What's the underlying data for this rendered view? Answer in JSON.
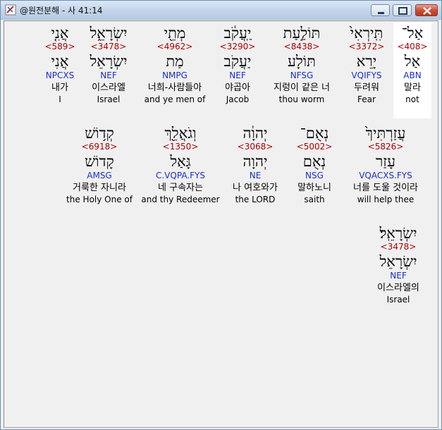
{
  "window": {
    "title": "@원전분해 - 사 41:14"
  },
  "words": [
    {
      "hebrew": "אַל־",
      "strong": "<408>",
      "lemma": "אַל",
      "morph": "ABN",
      "korean": "말라",
      "english": "not"
    },
    {
      "hebrew": "תִּֽירְאִי֙",
      "strong": "<3372>",
      "lemma": "יָרֵא",
      "morph": "VQIFYS",
      "korean": "두려워",
      "english": "Fear"
    },
    {
      "hebrew": "תּוֹלַ֣עַת",
      "strong": "<8438>",
      "lemma": "תּוֹלָע",
      "morph": "NFSG",
      "korean": "지렁이 같은 너",
      "english": "thou worm"
    },
    {
      "hebrew": "יַֽעֲקֹ֔ב",
      "strong": "<3290>",
      "lemma": "יַעֲקֹב",
      "morph": "NEF",
      "korean": "야곱아",
      "english": "Jacob"
    },
    {
      "hebrew": "מְתֵ֖י",
      "strong": "<4962>",
      "lemma": "מַת",
      "morph": "NMPG",
      "korean": "너희-사람들아",
      "english": "and ye men of"
    },
    {
      "hebrew": "יִשְׂרָאֵ֑ל",
      "strong": "<3478>",
      "lemma": "יִשְׂרָאֵל",
      "morph": "NEF",
      "korean": "이스라엘",
      "english": "Israel"
    },
    {
      "hebrew": "אֲנִ֤י",
      "strong": "<589>",
      "lemma": "אֲנִי",
      "morph": "NPCXS",
      "korean": "내가",
      "english": "I"
    },
    {
      "hebrew": "עֲזַרְתִּיךְ֙",
      "strong": "<5826>",
      "lemma": "עָזַר",
      "morph": "VQACXS.FYS",
      "korean": "너를 도울 것이라",
      "english": "will help thee"
    },
    {
      "hebrew": "נְאֻם־",
      "strong": "<5002>",
      "lemma": "נְאֻם",
      "morph": "NSG",
      "korean": "말하노니",
      "english": "saith"
    },
    {
      "hebrew": "יְהוָ֔ה",
      "strong": "<3068>",
      "lemma": "יְהוָה",
      "morph": "NE",
      "korean": "나 여호와가",
      "english": "the LORD"
    },
    {
      "hebrew": "וְגֹאֲלֵ֖ךְ",
      "strong": "<1350>",
      "lemma": "גָּאַל",
      "morph": "C.VQPA.FYS",
      "korean": "네 구속자는",
      "english": "and thy Redeemer"
    },
    {
      "hebrew": "קְד֥וֹשׁ",
      "strong": "<6918>",
      "lemma": "קָדוֹשׁ",
      "morph": "AMSG",
      "korean": "거룩한 자니라",
      "english": "the Holy One of"
    },
    {
      "hebrew": "יִשְׂרָאֵֽל׃",
      "strong": "<3478>",
      "lemma": "יִשְׂרָאֵל",
      "morph": "NEF",
      "korean": "이스라엘의",
      "english": "Israel"
    }
  ]
}
